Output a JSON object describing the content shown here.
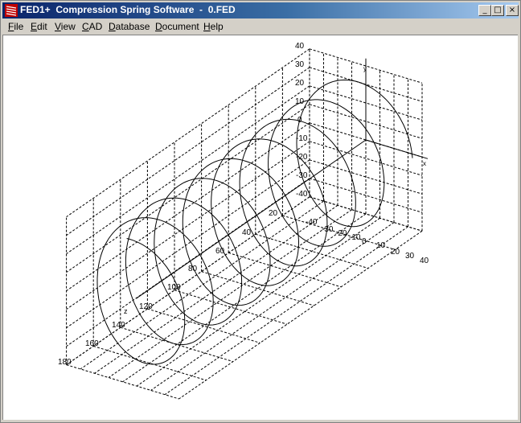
{
  "window": {
    "title": "FED1+  Compression Spring Software  -  0.FED",
    "buttons": {
      "minimize": "_",
      "maximize": "□",
      "close": "×"
    }
  },
  "menu": [
    {
      "id": "file",
      "mnemonic": "F",
      "rest": "ile"
    },
    {
      "id": "edit",
      "mnemonic": "E",
      "rest": "dit"
    },
    {
      "id": "view",
      "mnemonic": "V",
      "rest": "iew"
    },
    {
      "id": "cad",
      "mnemonic": "C",
      "rest": "AD"
    },
    {
      "id": "database",
      "mnemonic": "D",
      "rest": "atabase"
    },
    {
      "id": "document",
      "mnemonic": "D",
      "rest": "ocument"
    },
    {
      "id": "help",
      "mnemonic": "H",
      "rest": "elp"
    }
  ],
  "plot": {
    "y_ticks": [
      "40",
      "30",
      "20",
      "10",
      "0",
      "-10",
      "-20",
      "-30",
      "-40"
    ],
    "z_ticks": [
      "20",
      "40",
      "60",
      "80",
      "100",
      "120",
      "140",
      "160",
      "180"
    ],
    "x_ticks": [
      "-40",
      "-30",
      "-20",
      "-10",
      "0",
      "10",
      "20",
      "30",
      "40"
    ],
    "axis_labels": {
      "x": "x",
      "y": "y",
      "z": "z"
    },
    "colors": {
      "line": "#000000",
      "grid": "#000000",
      "background": "#ffffff"
    }
  }
}
